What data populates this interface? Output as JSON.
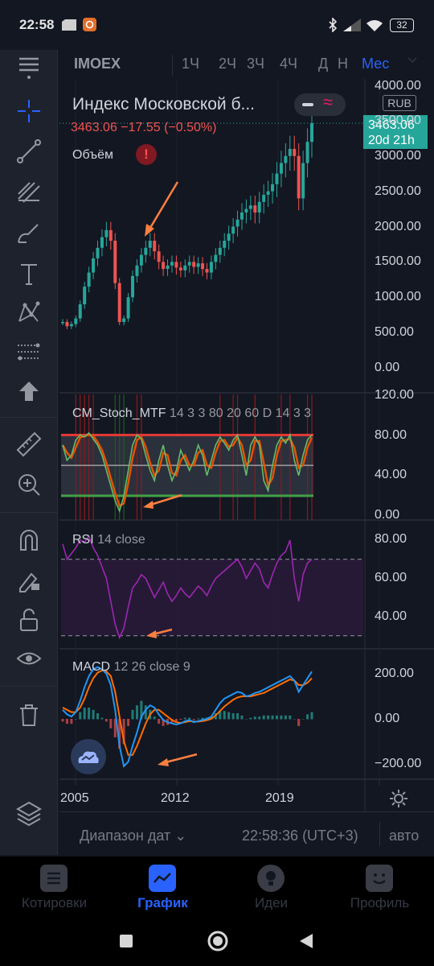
{
  "status_bar": {
    "time": "22:58",
    "battery": "32"
  },
  "header": {
    "symbol": "IMOEX",
    "timeframes": [
      "1Ч",
      "2Ч",
      "3Ч",
      "4Ч",
      "Д",
      "Н",
      "Мес"
    ],
    "active_timeframe": "Мес"
  },
  "legend": {
    "title": "Индекс Московской б...",
    "ohlc": "3463.06  −17.55 (−0.50%)",
    "volume_label": "Объём",
    "volume_alert": "!",
    "currency": "RUB"
  },
  "price_tag": {
    "price": "3463.06",
    "countdown": "20d 21h"
  },
  "panes": {
    "main": {
      "axis": [
        "4000.00",
        "3500.00",
        "3000.00",
        "2500.00",
        "2000.00",
        "1500.00",
        "1000.00",
        "500.00",
        "0.00"
      ]
    },
    "stoch": {
      "name": "CM_Stoch_MTF",
      "params": "14 3 3 80 20 60 D 14 3 3",
      "axis": [
        "120.00",
        "80.00",
        "40.00",
        "0.00"
      ]
    },
    "rsi": {
      "name": "RSI",
      "params": "14 close",
      "axis": [
        "80.00",
        "60.00",
        "40.00"
      ]
    },
    "macd": {
      "name": "MACD",
      "params": "12 26 close 9",
      "axis": [
        "200.00",
        "0.00",
        "−200.00"
      ]
    }
  },
  "time_axis": [
    "2005",
    "2012",
    "2019"
  ],
  "infobar": {
    "range": "Диапазон дат ⌄",
    "time": "22:58:36 (UTC+3)",
    "scale": "авто"
  },
  "bottom_nav": [
    {
      "label": "Котировки",
      "active": false
    },
    {
      "label": "График",
      "active": true
    },
    {
      "label": "Идеи",
      "active": false
    },
    {
      "label": "Профиль",
      "active": false
    }
  ],
  "colors": {
    "up": "#26a69a",
    "down": "#ef5350",
    "accent": "#2962ff",
    "rsi": "#9c27b0",
    "macd": "#2196f3",
    "signal": "#ff6d00"
  },
  "series": {
    "price": [
      650,
      590,
      620,
      700,
      900,
      1150,
      1350,
      1550,
      1700,
      1850,
      1950,
      1800,
      1200,
      650,
      700,
      1000,
      1300,
      1450,
      1600,
      1700,
      1800,
      1650,
      1500,
      1400,
      1450,
      1500,
      1420,
      1380,
      1450,
      1500,
      1430,
      1480,
      1400,
      1350,
      1500,
      1600,
      1700,
      1800,
      1900,
      2000,
      2100,
      2200,
      2250,
      2300,
      2200,
      2350,
      2450,
      2500,
      2600,
      2750,
      2900,
      3000,
      3100,
      3000,
      2400,
      2900,
      3200,
      3463
    ],
    "stoch": [
      70,
      55,
      60,
      75,
      80,
      78,
      82,
      76,
      70,
      60,
      45,
      30,
      15,
      5,
      20,
      45,
      70,
      80,
      76,
      60,
      45,
      35,
      55,
      70,
      50,
      35,
      45,
      65,
      55,
      45,
      55,
      70,
      60,
      40,
      55,
      70,
      78,
      72,
      65,
      75,
      80,
      60,
      40,
      70,
      78,
      70,
      35,
      25,
      50,
      70,
      78,
      72,
      80,
      55,
      40,
      60,
      75,
      80
    ],
    "rsi": [
      78,
      70,
      73,
      76,
      80,
      79,
      82,
      76,
      72,
      66,
      60,
      48,
      36,
      29,
      34,
      45,
      55,
      58,
      62,
      60,
      55,
      50,
      54,
      58,
      52,
      48,
      51,
      55,
      52,
      50,
      53,
      56,
      54,
      51,
      56,
      60,
      62,
      64,
      66,
      68,
      70,
      66,
      60,
      64,
      68,
      65,
      58,
      55,
      62,
      68,
      72,
      74,
      80,
      60,
      48,
      62,
      68,
      70
    ],
    "macd": [
      40,
      20,
      10,
      30,
      80,
      140,
      190,
      220,
      230,
      220,
      200,
      150,
      40,
      -120,
      -210,
      -190,
      -120,
      -60,
      10,
      40,
      60,
      50,
      20,
      -5,
      -15,
      -20,
      -25,
      -20,
      -10,
      -5,
      -15,
      -10,
      -5,
      0,
      10,
      40,
      70,
      90,
      100,
      110,
      120,
      115,
      100,
      105,
      115,
      120,
      130,
      140,
      150,
      160,
      170,
      180,
      190,
      170,
      120,
      150,
      180,
      210
    ],
    "signal": [
      50,
      40,
      30,
      30,
      50,
      90,
      140,
      180,
      205,
      215,
      210,
      190,
      120,
      10,
      -100,
      -160,
      -160,
      -120,
      -70,
      -20,
      20,
      40,
      40,
      25,
      10,
      -5,
      -15,
      -18,
      -15,
      -10,
      -12,
      -12,
      -10,
      -6,
      0,
      15,
      35,
      55,
      70,
      85,
      95,
      100,
      100,
      100,
      105,
      110,
      115,
      125,
      135,
      145,
      155,
      165,
      175,
      170,
      150,
      150,
      160,
      180
    ]
  }
}
